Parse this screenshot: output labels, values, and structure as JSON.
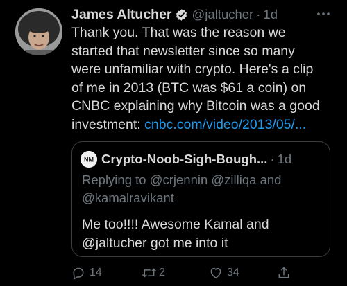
{
  "tweet": {
    "name": "James Altucher",
    "handle": "@jaltucher",
    "separator": "·",
    "time": "1d",
    "text_lines": [
      "Thank you. That was the reason we",
      "started that newsletter since so many",
      "were unfamiliar with crypto. Here's a clip",
      "of me in 2013 (BTC was $61 a coin) on",
      "CNBC explaining why Bitcoin was a good"
    ],
    "text_last_prefix": "investment: ",
    "link_text": "cnbc.com/video/2013/05/...",
    "colors": {
      "link": "#1d9bf0",
      "muted": "#6e767d",
      "text": "#d9d9d9",
      "background": "#000000"
    }
  },
  "quote": {
    "name": "Crypto-Noob-Sigh-Bough...",
    "separator": "·",
    "time": "1d",
    "reply_line1": "Replying to @crjennin @zilliqa and",
    "reply_line2": "@kamalravikant",
    "text_line1": "Me too!!!! Awesome  Kamal and",
    "text_line2": "@jaltucher got me into it"
  },
  "actions": {
    "reply_icon": "reply-icon",
    "reply_count": "14",
    "retweet_icon": "retweet-icon",
    "retweet_count": "2",
    "like_icon": "heart-icon",
    "like_count": "34",
    "share_icon": "share-icon"
  }
}
